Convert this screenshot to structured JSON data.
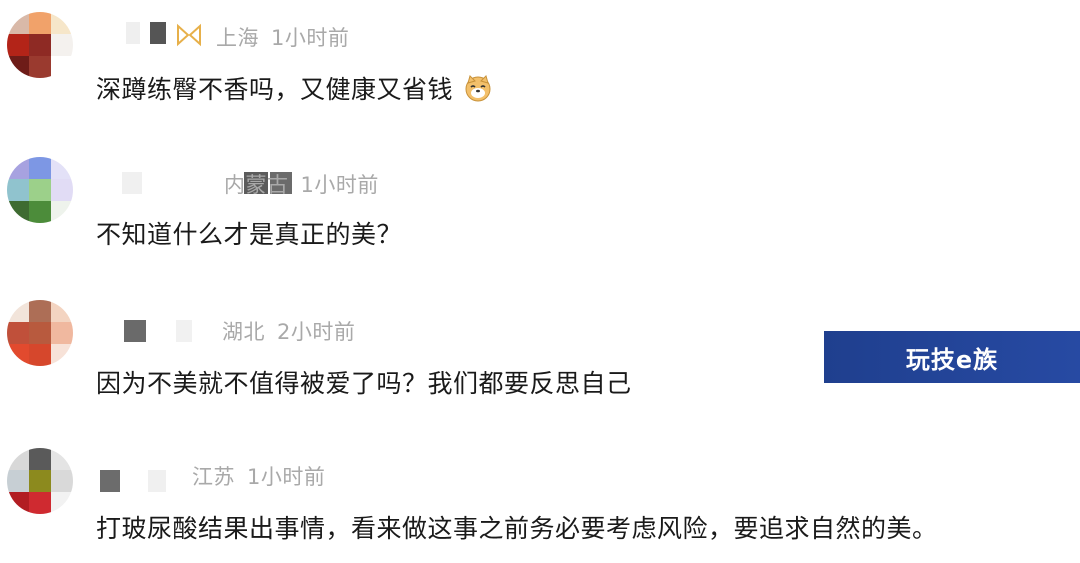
{
  "comments": [
    {
      "location": "上海",
      "time": "1小时前",
      "text": "深蹲练臀不香吗，又健康又省钱",
      "avatar_colors": [
        "#d9b9a8",
        "#f1a26a",
        "#f6e6c9",
        "#b32418",
        "#8e2a24",
        "#f4f1ee",
        "#6e1c18",
        "#9a3a2f",
        "#ffffff"
      ],
      "emoji": "dog-face-emoji"
    },
    {
      "location": "内蒙古",
      "time": "1小时前",
      "text": "不知道什么才是真正的美？",
      "avatar_colors": [
        "#a7a2e0",
        "#7d97e4",
        "#e3e1f7",
        "#90c3ce",
        "#9cd08a",
        "#e1dcf5",
        "#3e6b31",
        "#4c8c3a",
        "#eef3ec"
      ]
    },
    {
      "location": "湖北",
      "time": "2小时前",
      "text": "因为不美就不值得被爱了吗？我们都要反思自己",
      "avatar_colors": [
        "#f2e4da",
        "#ad6e56",
        "#f3d4c1",
        "#c0503a",
        "#b85a3e",
        "#f0b89f",
        "#e24a2e",
        "#d6472c",
        "#f7e2d8"
      ]
    },
    {
      "location": "江苏",
      "time": "1小时前",
      "text": "打玻尿酸结果出事情，看来做这事之前务必要考虑风险，要追求自然的美。",
      "avatar_colors": [
        "#d8d8d8",
        "#5a5a5a",
        "#e4e4e4",
        "#c7cfd4",
        "#8c8a1e",
        "#d9d9d9",
        "#b21d22",
        "#cf2a30",
        "#f2f2f2"
      ]
    }
  ],
  "watermark": {
    "label": "玩技e族",
    "color": "#23448f"
  }
}
